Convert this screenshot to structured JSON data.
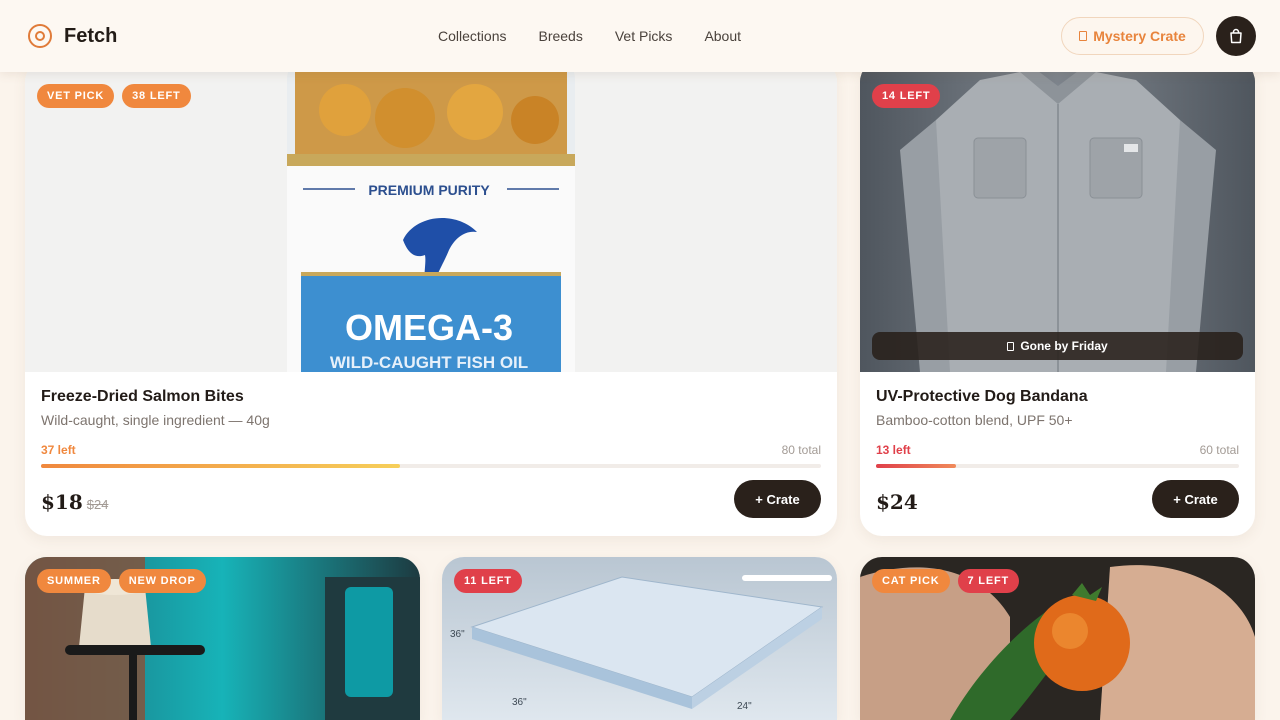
{
  "header": {
    "brand": "Fetch",
    "nav": [
      "Collections",
      "Breeds",
      "Vet Picks",
      "About"
    ],
    "mystery_label": "Mystery Crate",
    "accent": "#e8843c"
  },
  "products": [
    {
      "badges": [
        "VET PICK",
        "38 LEFT"
      ],
      "title": "Freeze-Dried Salmon Bites",
      "subtitle": "Wild-caught, single ingredient — 40g",
      "stock_left": "37 left",
      "stock_total": "80 total",
      "stock_fraction": 0.46,
      "price": "$18",
      "old_price": "$24",
      "button": "+ Crate",
      "image_text": {
        "top": "PREMIUM PURITY",
        "main": "OMEGA-3",
        "sub": "WILD-CAUGHT FISH OIL"
      }
    },
    {
      "badges": [
        "14 LEFT"
      ],
      "title": "UV-Protective Dog Bandana",
      "subtitle": "Bamboo-cotton blend, UPF 50+",
      "stock_left": "13 left",
      "stock_total": "60 total",
      "stock_fraction": 0.22,
      "price": "$24",
      "button": "+ Crate",
      "overlay": "Gone by Friday"
    },
    {
      "badges": [
        "SUMMER",
        "NEW DROP"
      ]
    },
    {
      "badges": [
        "11 LEFT"
      ],
      "image_text": {
        "height": "36\"",
        "width": "36\"",
        "depth": "24\""
      }
    },
    {
      "badges": [
        "CAT PICK",
        "7 LEFT"
      ]
    }
  ],
  "colors": {
    "accent_orange": "#f0883e",
    "alert_red": "#e0404a",
    "dark": "#2a211b"
  }
}
